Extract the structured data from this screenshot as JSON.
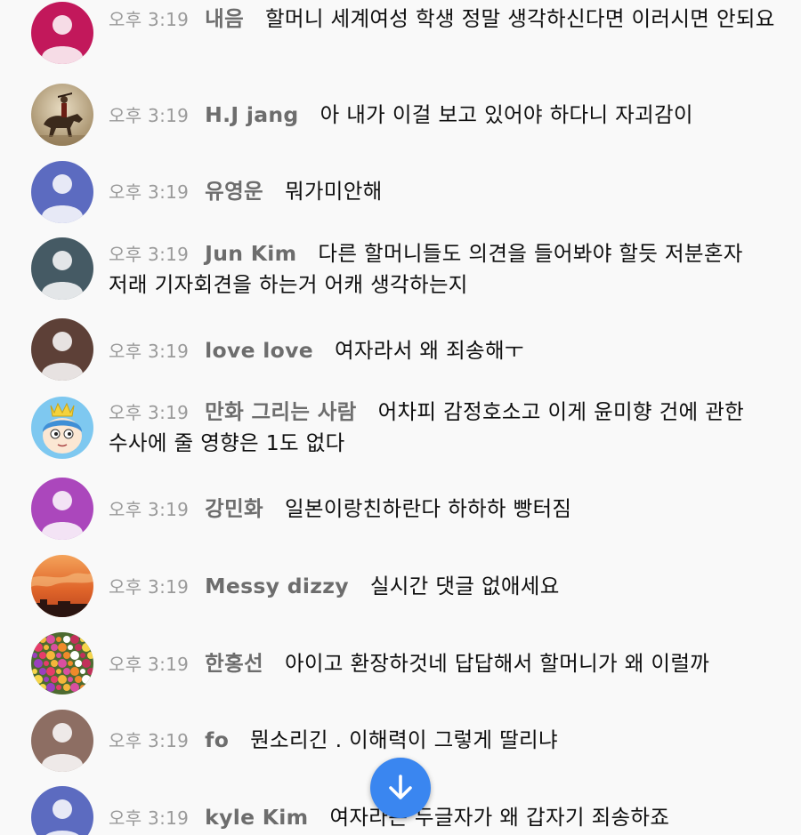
{
  "messages": [
    {
      "time": "오후 3:19",
      "author": "내음",
      "text": "할머니 세계여성 학생 정말 생각하신다면 이러시면 안되요",
      "avatar": {
        "kind": "person-icon",
        "bg": "#c2185b"
      }
    },
    {
      "time": "오후 3:19",
      "author": "H.J jang",
      "text": "아 내가 이걸 보고 있어야 하다니 자괴감이",
      "avatar": {
        "kind": "horse-rider-photo",
        "bg": "#b9a88a"
      }
    },
    {
      "time": "오후 3:19",
      "author": "유영운",
      "text": "뭐가미안해",
      "avatar": {
        "kind": "person-icon",
        "bg": "#5c6bc0"
      }
    },
    {
      "time": "오후 3:19",
      "author": "Jun Kim",
      "text": "다른 할머니들도 의견을 들어봐야 할듯 저분혼자 저래 기자회견을 하는거 어캐 생각하는지",
      "avatar": {
        "kind": "person-icon",
        "bg": "#455a64"
      }
    },
    {
      "time": "오후 3:19",
      "author": "love love",
      "text": "여자라서 왜 죄송해ㅜ",
      "avatar": {
        "kind": "person-icon",
        "bg": "#5d4037"
      }
    },
    {
      "time": "오후 3:19",
      "author": "만화 그리는 사람",
      "text": "어차피 감정호소고 이게 윤미향 건에 관한 수사에 줄 영향은 1도 없다",
      "avatar": {
        "kind": "cartoon-face",
        "bg": "#7ec8f0"
      }
    },
    {
      "time": "오후 3:19",
      "author": "강민화",
      "text": "일본이랑친하란다 하하하 빵터짐",
      "avatar": {
        "kind": "person-icon",
        "bg": "#ab47bc"
      }
    },
    {
      "time": "오후 3:19",
      "author": "Messy dizzy",
      "text": "실시간 댓글 없애세요",
      "avatar": {
        "kind": "sunset-photo",
        "bg": "#e07a2e"
      }
    },
    {
      "time": "오후 3:19",
      "author": "한홍선",
      "text": "아이고 환장하것네 답답해서 할머니가 왜 이럴까",
      "avatar": {
        "kind": "flowers-photo",
        "bg": "#5a7a3a"
      }
    },
    {
      "time": "오후 3:19",
      "author": "fo",
      "text": "뭔소리긴 . 이해력이 그렇게 딸리냐",
      "avatar": {
        "kind": "person-icon",
        "bg": "#8d6e63"
      }
    },
    {
      "time": "오후 3:19",
      "author": "kyle Kim",
      "text": "여자라는 두글자가 왜 갑자기 죄송하죠",
      "avatar": {
        "kind": "person-icon",
        "bg": "#5c6bc0"
      }
    }
  ],
  "fab": {
    "icon": "arrow-down-icon",
    "color": "#3a86f0"
  }
}
